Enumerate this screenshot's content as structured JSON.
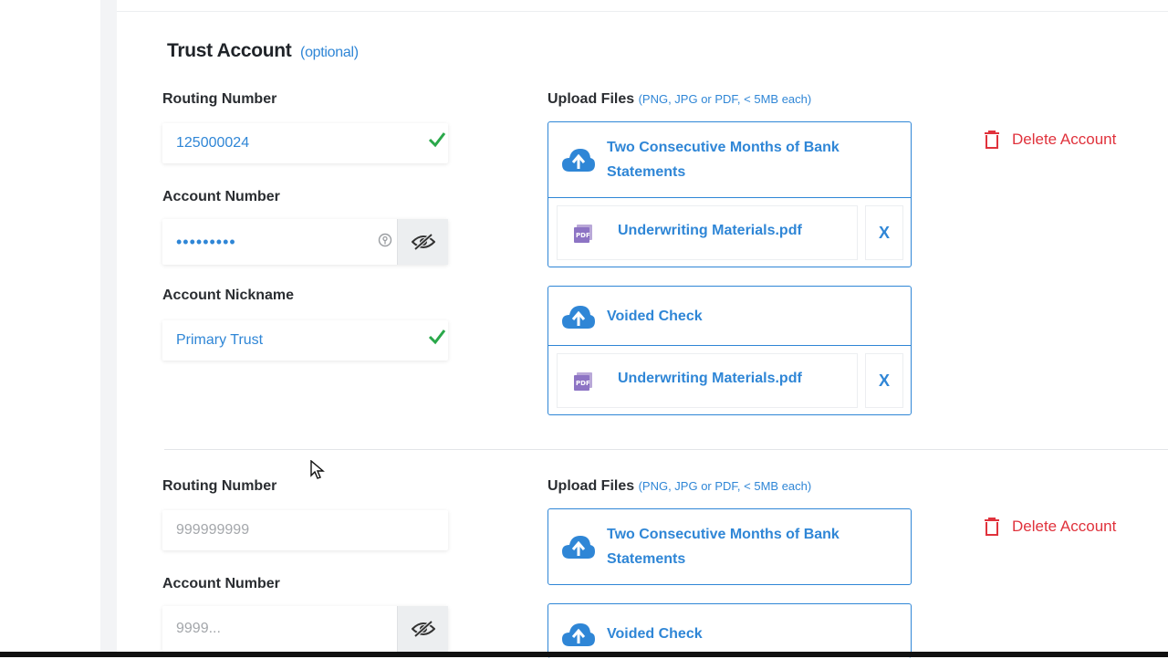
{
  "section": {
    "title": "Trust Account",
    "optional": "(optional)"
  },
  "accounts": [
    {
      "routing_label": "Routing Number",
      "routing_value": "125000024",
      "account_label": "Account Number",
      "account_value": "•••••••••",
      "nickname_label": "Account Nickname",
      "nickname_value": "Primary Trust",
      "upload_label": "Upload Files",
      "upload_hint": "(PNG, JPG or PDF, < 5MB each)",
      "delete_label": "Delete Account",
      "uploads": [
        {
          "title": "Two Consecutive Months of Bank Statements",
          "file": "Underwriting Materials.pdf",
          "remove": "X"
        },
        {
          "title": "Voided Check",
          "file": "Underwriting Materials.pdf",
          "remove": "X"
        }
      ]
    },
    {
      "routing_label": "Routing Number",
      "routing_placeholder": "999999999",
      "account_label": "Account Number",
      "account_placeholder": "9999...",
      "upload_label": "Upload Files",
      "upload_hint": "(PNG, JPG or PDF, < 5MB each)",
      "delete_label": "Delete Account",
      "uploads": [
        {
          "title": "Two Consecutive Months of Bank Statements"
        },
        {
          "title": "Voided Check"
        }
      ]
    }
  ],
  "colors": {
    "accent": "#2f86d6",
    "success": "#2aa84a",
    "danger": "#e0323c"
  }
}
